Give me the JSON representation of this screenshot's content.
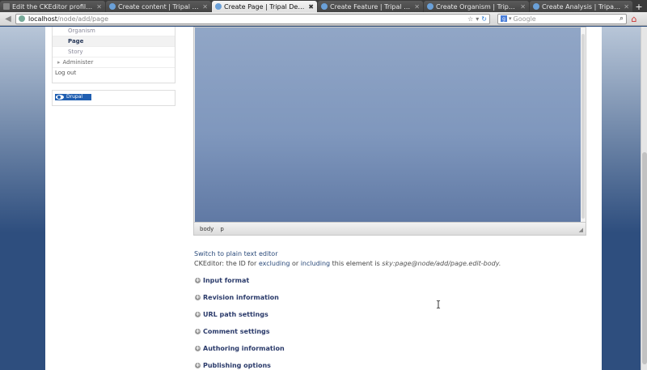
{
  "browser": {
    "tabs": [
      {
        "title": "Edit the CKEditor profile | T...",
        "active": false,
        "fav": "ck"
      },
      {
        "title": "Create content | Tripal Demo",
        "active": false,
        "fav": "drupal"
      },
      {
        "title": "Create Page | Tripal Demo",
        "active": true,
        "fav": "drupal"
      },
      {
        "title": "Create Feature | Tripal Demo",
        "active": false,
        "fav": "drupal"
      },
      {
        "title": "Create Organism | Tripal De...",
        "active": false,
        "fav": "drupal"
      },
      {
        "title": "Create Analysis | Tripal Demo",
        "active": false,
        "fav": "drupal"
      }
    ],
    "url_host": "localhost",
    "url_path": "/node/add/page",
    "search_placeholder": "Google",
    "new_tab_label": "+"
  },
  "sidebar": {
    "items": [
      {
        "label": "Organism",
        "level": "sub"
      },
      {
        "label": "Page",
        "level": "active"
      },
      {
        "label": "Story",
        "level": "sub"
      },
      {
        "label": "Administer",
        "level": "top"
      },
      {
        "label": "Log out",
        "level": "root"
      }
    ],
    "drupal_badge": "Drupal"
  },
  "editor": {
    "path": [
      "body",
      "p"
    ]
  },
  "switch_link": "Switch to plain text editor",
  "ckinfo": {
    "prefix": "CKEditor: the ID for",
    "link1": "excluding",
    "or": "or",
    "link2": "including",
    "mid": "this element is",
    "id": "sky:page@node/add/page.edit-body."
  },
  "fieldsets": [
    "Input format",
    "Revision information",
    "URL path settings",
    "Comment settings",
    "Authoring information",
    "Publishing options"
  ],
  "colors": {
    "link": "#2a4a7a",
    "drupal_blue": "#1f5eb1",
    "page_bg": "#2e4e7e"
  }
}
